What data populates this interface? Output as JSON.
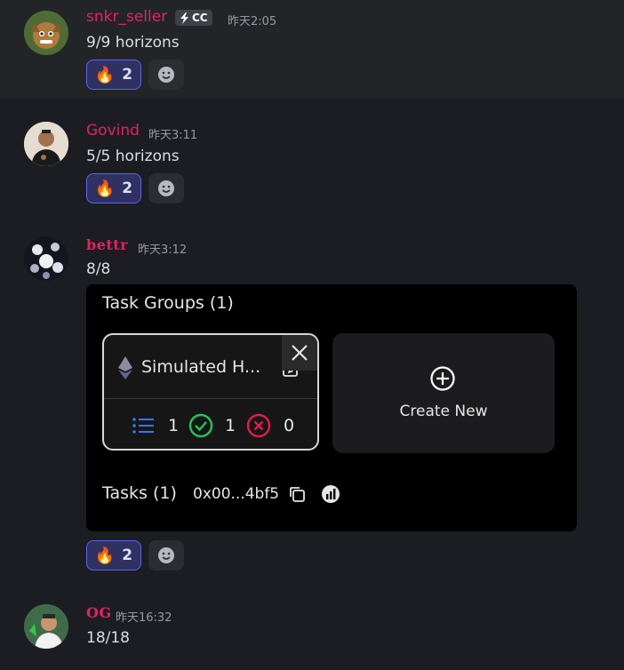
{
  "messages": [
    {
      "username": "snkr_seller",
      "badge": "CC",
      "time": "昨天2:05",
      "text": "9/9 horizons",
      "reaction": {
        "emoji": "🔥",
        "count": "2"
      }
    },
    {
      "username": "Govind",
      "time": "昨天3:11",
      "text": "5/5 horizons",
      "reaction": {
        "emoji": "🔥",
        "count": "2"
      }
    },
    {
      "username": "bettr",
      "time": "昨天3:12",
      "text": "8/8",
      "reaction": {
        "emoji": "🔥",
        "count": "2"
      },
      "embed": {
        "title": "Task Groups (1)",
        "group_name": "Simulated H...",
        "stats": {
          "tasks": "1",
          "success": "1",
          "failed": "0"
        },
        "create_label": "Create New",
        "tasks_label": "Tasks (1)",
        "address": "0x00...4bf5"
      }
    },
    {
      "username": "OG",
      "time": "昨天16:32",
      "text": "18/18"
    }
  ],
  "colors": {
    "username": "#e0245e",
    "reaction_bg": "#2f3161",
    "reaction_border": "#5865f2"
  }
}
